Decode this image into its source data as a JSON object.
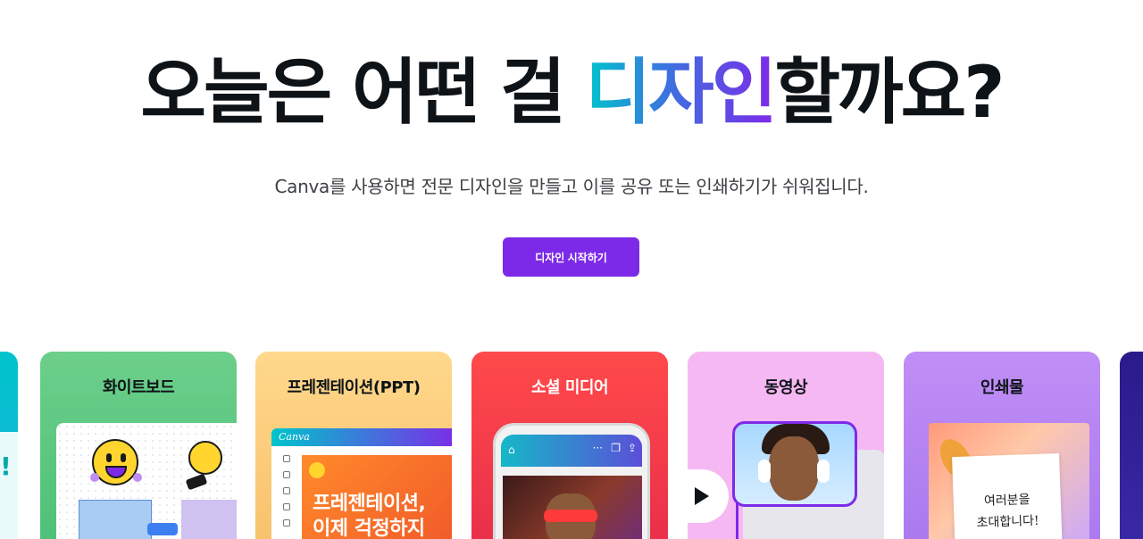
{
  "hero": {
    "title_part1": "오늘은 어떤 걸 ",
    "title_highlight": "디자인",
    "title_part2": "할까요?",
    "subtitle": "Canva를 사용하면 전문 디자인을 만들고 이를 공유 또는 인쇄하기가 쉬워집니다.",
    "cta_label": "디자인 시작하기",
    "highlight_gradient": [
      "#00c4cc",
      "#3f6fe0",
      "#7d2ae8"
    ],
    "cta_color": "#7d2ae8"
  },
  "categories": [
    {
      "id": "whiteboard",
      "label": "화이트보드",
      "color": "#6ccf8a"
    },
    {
      "id": "presentation",
      "label": "프레젠테이션(PPT)",
      "color": "#ffd88c",
      "preview": {
        "app_logo": "Canva",
        "slide_line1": "프레젠테이션,",
        "slide_line2": "이제 걱정하지"
      }
    },
    {
      "id": "social-media",
      "label": "소셜 미디어",
      "color": "#ff4a4a",
      "preview": {
        "toolbar_dots": "···"
      }
    },
    {
      "id": "video",
      "label": "동영상",
      "color": "#f6b8f3"
    },
    {
      "id": "print",
      "label": "인쇄물",
      "color": "#c08ef5",
      "preview": {
        "card_line1": "여러분을",
        "card_line2": "초대합니다!"
      }
    }
  ],
  "partial_left": {
    "mark": "!"
  }
}
